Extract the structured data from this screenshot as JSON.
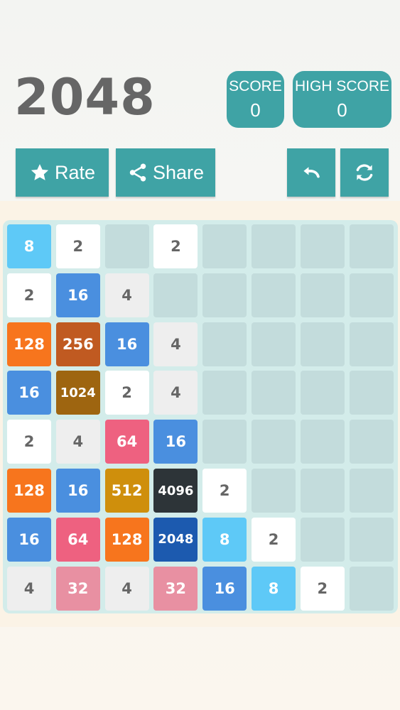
{
  "header": {
    "title": "2048",
    "score_label": "SCORE",
    "score_value": "0",
    "high_score_label": "HIGH SCORE",
    "high_score_value": "0"
  },
  "toolbar": {
    "rate_label": "Rate",
    "share_label": "Share",
    "undo_icon": "undo-icon",
    "restart_icon": "restart-icon"
  },
  "colors": {
    "accent": "#3fa3a5",
    "empty_cell": "#c3dcdc",
    "board": "#d3ecea"
  },
  "board": {
    "rows": 8,
    "cols": 8,
    "tiles": [
      [
        "8",
        "2",
        "",
        "2",
        "",
        "",
        "",
        ""
      ],
      [
        "2",
        "16",
        "4",
        "",
        "",
        "",
        "",
        ""
      ],
      [
        "128",
        "256",
        "16",
        "4",
        "",
        "",
        "",
        ""
      ],
      [
        "16",
        "1024",
        "2",
        "4",
        "",
        "",
        "",
        ""
      ],
      [
        "2",
        "4",
        "64",
        "16",
        "",
        "",
        "",
        ""
      ],
      [
        "128",
        "16",
        "512",
        "4096",
        "2",
        "",
        "",
        ""
      ],
      [
        "16",
        "64",
        "128",
        "2048",
        "8",
        "2",
        "",
        ""
      ],
      [
        "4",
        "32",
        "4",
        "32",
        "16",
        "8",
        "2",
        ""
      ]
    ],
    "tile_colors": {
      "2": {
        "bg": "#ffffff",
        "fg": "#666666"
      },
      "4": {
        "bg": "#eeeeee",
        "fg": "#666666"
      },
      "8": {
        "bg": "#5ec9f7",
        "fg": "#ffffff"
      },
      "16": {
        "bg": "#4a8fdf",
        "fg": "#ffffff"
      },
      "32": {
        "bg": "#e890a2",
        "fg": "#ffffff"
      },
      "64": {
        "bg": "#ee6180",
        "fg": "#ffffff"
      },
      "128": {
        "bg": "#f7751d",
        "fg": "#ffffff"
      },
      "256": {
        "bg": "#c05a21",
        "fg": "#ffffff"
      },
      "512": {
        "bg": "#cf8f0c",
        "fg": "#ffffff"
      },
      "1024": {
        "bg": "#9e6510",
        "fg": "#ffffff"
      },
      "2048": {
        "bg": "#1c5aaf",
        "fg": "#ffffff"
      },
      "4096": {
        "bg": "#2d3438",
        "fg": "#ffffff"
      }
    }
  }
}
